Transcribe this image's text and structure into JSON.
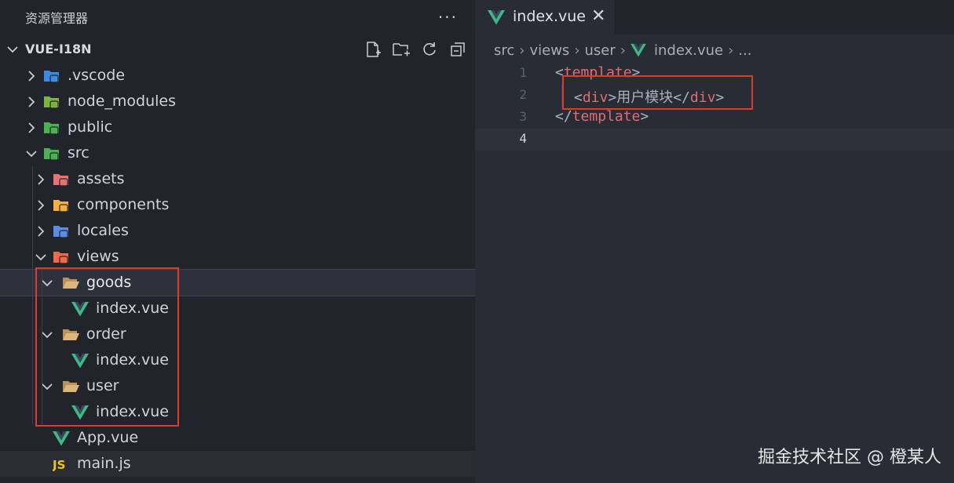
{
  "explorer": {
    "title": "资源管理器",
    "more": "···",
    "project": "VUE-I18N",
    "actions": [
      "new-file-icon",
      "new-folder-icon",
      "refresh-icon",
      "collapse-all-icon"
    ],
    "items": [
      {
        "label": ".vscode",
        "type": "folder",
        "expanded": false,
        "icon": "vscode-folder-icon",
        "color": "#3b8be0"
      },
      {
        "label": "node_modules",
        "type": "folder",
        "expanded": false,
        "icon": "node-folder-icon",
        "color": "#7cb342"
      },
      {
        "label": "public",
        "type": "folder",
        "expanded": false,
        "icon": "public-folder-icon",
        "color": "#4caf50"
      },
      {
        "label": "src",
        "type": "folder",
        "expanded": true,
        "icon": "src-folder-icon",
        "color": "#4caf50"
      },
      {
        "label": "assets",
        "type": "folder",
        "expanded": false,
        "icon": "assets-folder-icon",
        "color": "#e57373"
      },
      {
        "label": "components",
        "type": "folder",
        "expanded": false,
        "icon": "components-folder-icon",
        "color": "#f5b041"
      },
      {
        "label": "locales",
        "type": "folder",
        "expanded": false,
        "icon": "locales-folder-icon",
        "color": "#5c8de6"
      },
      {
        "label": "views",
        "type": "folder",
        "expanded": true,
        "icon": "views-folder-icon",
        "color": "#ef6c4a"
      },
      {
        "label": "goods",
        "type": "folder",
        "expanded": true,
        "icon": "folder-open-icon",
        "color": "#dcb67a"
      },
      {
        "label": "index.vue",
        "type": "file",
        "icon": "vue-file-icon",
        "color": "#41b883"
      },
      {
        "label": "order",
        "type": "folder",
        "expanded": true,
        "icon": "folder-open-icon",
        "color": "#dcb67a"
      },
      {
        "label": "index.vue",
        "type": "file",
        "icon": "vue-file-icon",
        "color": "#41b883"
      },
      {
        "label": "user",
        "type": "folder",
        "expanded": true,
        "icon": "folder-open-icon",
        "color": "#dcb67a"
      },
      {
        "label": "index.vue",
        "type": "file",
        "icon": "vue-file-icon",
        "color": "#41b883"
      },
      {
        "label": "App.vue",
        "type": "file",
        "icon": "vue-file-icon",
        "color": "#41b883"
      },
      {
        "label": "main.js",
        "type": "file",
        "icon": "js-file-icon",
        "color": "#f0c419"
      }
    ]
  },
  "editor": {
    "tab": {
      "name": "index.vue",
      "close": "✕"
    },
    "breadcrumb": [
      "src",
      "views",
      "user",
      "index.vue",
      "..."
    ],
    "lines": [
      {
        "n": "1",
        "open": "<",
        "tag": "template",
        "close": ">",
        "text": ""
      },
      {
        "n": "2",
        "open": "<",
        "tag": "div",
        "close": ">",
        "text": "用户模块",
        "endOpen": "</",
        "endTag": "div",
        "endClose": ">"
      },
      {
        "n": "3",
        "open": "</",
        "tag": "template",
        "close": ">",
        "text": ""
      },
      {
        "n": "4",
        "open": "",
        "tag": "",
        "close": "",
        "text": ""
      }
    ]
  },
  "watermark": "掘金技术社区 @ 橙某人",
  "colors": {
    "accent_red": "#e03a2b",
    "vue_green": "#41b883",
    "tag_red": "#e06c75"
  }
}
